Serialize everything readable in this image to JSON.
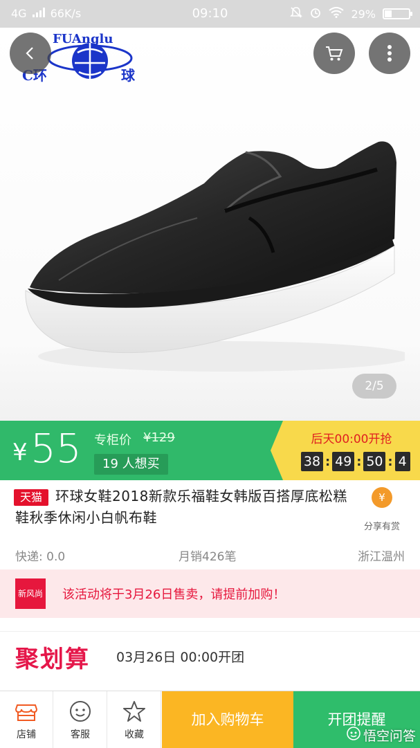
{
  "status_bar": {
    "network": "4G",
    "speed": "66K/s",
    "time": "09:10",
    "battery": "29%",
    "battery_level": 0.29
  },
  "hero": {
    "logo_text_top": "FUAnglu",
    "logo_text_left": "C环",
    "logo_text_right": "球",
    "image_counter": "2/5"
  },
  "price": {
    "currency": "¥",
    "current": "55",
    "original_label": "专柜价",
    "original_price": "¥129",
    "want_count": "19 人想买"
  },
  "countdown": {
    "label": "后天00:00开抢",
    "digits": [
      "38",
      "49",
      "50",
      "4"
    ]
  },
  "product": {
    "badge": "天猫",
    "title": "环球女鞋2018新款乐福鞋女韩版百搭厚底松糕鞋秋季休闲小白帆布鞋",
    "share_label": "分享有赏",
    "shipping": "快递: 0.0",
    "monthly_sales": "月销426笔",
    "location": "浙江温州"
  },
  "notice": {
    "badge": "新风尚",
    "text": "该活动将于3月26日售卖，请提前加购！"
  },
  "juhuasuan": {
    "brand": "聚划算",
    "open_time": "03月26日 00:00开团"
  },
  "bottom_bar": {
    "store": "店铺",
    "service": "客服",
    "favorite": "收藏",
    "add_to_cart": "加入购物车",
    "remind": "开团提醒",
    "watermark": "悟空问答"
  },
  "colors": {
    "price_green": "#30b96a",
    "countdown_yellow": "#f8d94b",
    "tmall_red": "#e4112c",
    "cart_orange": "#fbb623",
    "remind_green": "#2fbd6b"
  }
}
